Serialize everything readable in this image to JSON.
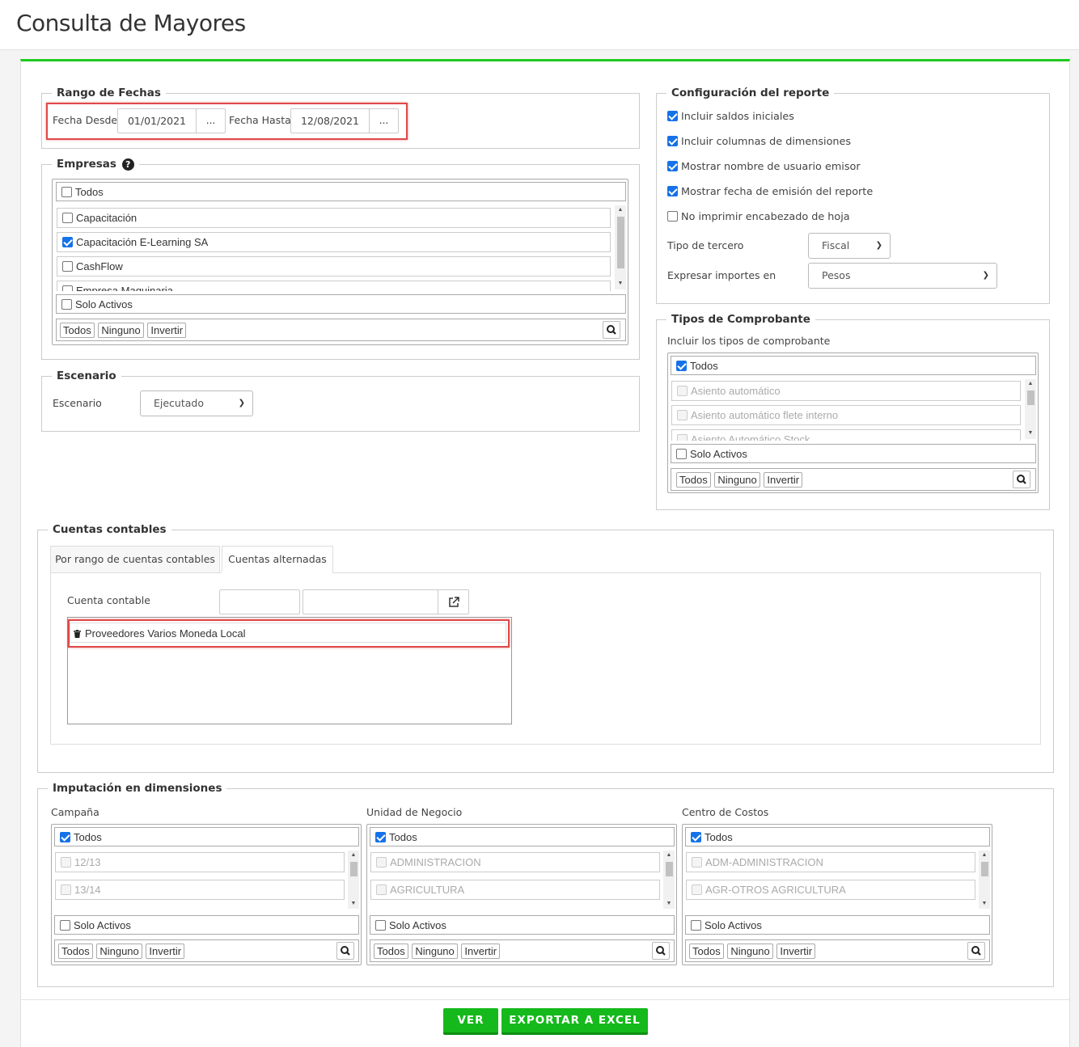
{
  "page": {
    "title": "Consulta de Mayores"
  },
  "rango_fechas": {
    "legend": "Rango de Fechas",
    "desde_label": "Fecha Desde",
    "desde_value": "01/01/2021",
    "hasta_label": "Fecha Hasta",
    "hasta_value": "12/08/2021",
    "dots": "..."
  },
  "empresas": {
    "legend": "Empresas",
    "todos": "Todos",
    "items": [
      {
        "label": "Capacitación",
        "checked": false
      },
      {
        "label": "Capacitación E-Learning SA",
        "checked": true
      },
      {
        "label": "CashFlow",
        "checked": false
      },
      {
        "label": "Empresa Maquinaria",
        "checked": false
      }
    ],
    "solo_activos": "Solo Activos",
    "btn_todos": "Todos",
    "btn_ninguno": "Ninguno",
    "btn_invertir": "Invertir"
  },
  "escenario": {
    "legend": "Escenario",
    "label": "Escenario",
    "value": "Ejecutado"
  },
  "config": {
    "legend": "Configuración del reporte",
    "options": [
      {
        "label": "Incluir saldos iniciales",
        "checked": true
      },
      {
        "label": "Incluir columnas de dimensiones",
        "checked": true
      },
      {
        "label": "Mostrar nombre de usuario emisor",
        "checked": true
      },
      {
        "label": "Mostrar fecha de emisión del reporte",
        "checked": true
      },
      {
        "label": "No imprimir encabezado de hoja",
        "checked": false
      }
    ],
    "tipo_tercero_label": "Tipo de tercero",
    "tipo_tercero_value": "Fiscal",
    "expresar_label": "Expresar importes en",
    "expresar_value": "Pesos"
  },
  "comprobantes": {
    "legend": "Tipos de Comprobante",
    "intro": "Incluir los tipos de comprobante",
    "todos": "Todos",
    "items": [
      "Asiento automático",
      "Asiento automático flete interno",
      "Asiento Automático Stock"
    ],
    "solo_activos": "Solo Activos",
    "btn_todos": "Todos",
    "btn_ninguno": "Ninguno",
    "btn_invertir": "Invertir"
  },
  "cuentas": {
    "legend": "Cuentas contables",
    "tab1": "Por rango de cuentas contables",
    "tab2": "Cuentas alternadas",
    "cuenta_label": "Cuenta contable",
    "selected_item": "Proveedores Varios Moneda Local"
  },
  "dimensiones": {
    "legend": "Imputación en dimensiones",
    "columns": [
      {
        "title": "Campaña",
        "todos": "Todos",
        "items": [
          "12/13",
          "13/14"
        ],
        "solo_activos": "Solo Activos",
        "btn_todos": "Todos",
        "btn_ninguno": "Ninguno",
        "btn_invertir": "Invertir"
      },
      {
        "title": "Unidad de Negocio",
        "todos": "Todos",
        "items": [
          "ADMINISTRACION",
          "AGRICULTURA"
        ],
        "solo_activos": "Solo Activos",
        "btn_todos": "Todos",
        "btn_ninguno": "Ninguno",
        "btn_invertir": "Invertir"
      },
      {
        "title": "Centro de Costos",
        "todos": "Todos",
        "items": [
          "ADM-ADMINISTRACION",
          "AGR-OTROS AGRICULTURA"
        ],
        "solo_activos": "Solo Activos",
        "btn_todos": "Todos",
        "btn_ninguno": "Ninguno",
        "btn_invertir": "Invertir"
      }
    ]
  },
  "actions": {
    "ver": "VER",
    "exportar": "EXPORTAR A EXCEL"
  },
  "colors": {
    "accent_green": "#1fc91f",
    "button_green": "#15b91b",
    "checkbox_blue": "#1672e8",
    "highlight_red": "#e04848"
  }
}
